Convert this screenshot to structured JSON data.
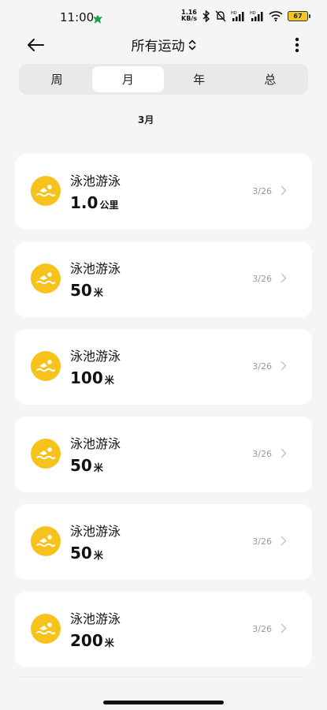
{
  "status_bar": {
    "time": "11:00",
    "net_speed_value": "1.16",
    "net_speed_unit": "KB/s",
    "battery": "67"
  },
  "header": {
    "title": "所有运动"
  },
  "tabs": [
    {
      "label": "周",
      "active": false
    },
    {
      "label": "月",
      "active": true
    },
    {
      "label": "年",
      "active": false
    },
    {
      "label": "总",
      "active": false
    }
  ],
  "month": "3月",
  "activities": [
    {
      "name": "泳池游泳",
      "value": "1.0",
      "unit": "公里",
      "date": "3/26"
    },
    {
      "name": "泳池游泳",
      "value": "50",
      "unit": "米",
      "date": "3/26"
    },
    {
      "name": "泳池游泳",
      "value": "100",
      "unit": "米",
      "date": "3/26"
    },
    {
      "name": "泳池游泳",
      "value": "50",
      "unit": "米",
      "date": "3/26"
    },
    {
      "name": "泳池游泳",
      "value": "50",
      "unit": "米",
      "date": "3/26"
    },
    {
      "name": "泳池游泳",
      "value": "200",
      "unit": "米",
      "date": "3/26"
    }
  ],
  "colors": {
    "accent": "#f7c21b",
    "background": "#f5f5f5",
    "card": "#ffffff"
  }
}
